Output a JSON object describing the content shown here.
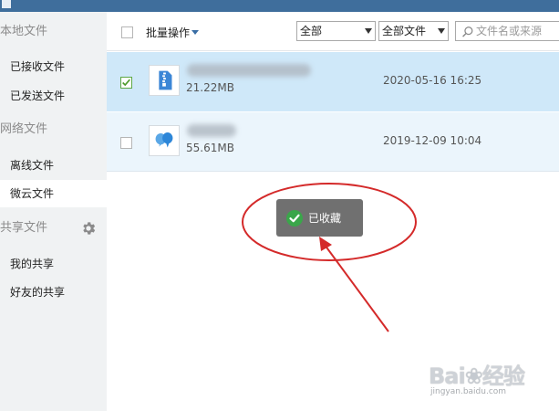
{
  "sidebar": {
    "sections": [
      {
        "label": "本地文件"
      },
      {
        "label": "网络文件"
      },
      {
        "label": "共享文件"
      }
    ],
    "items": [
      {
        "label": "已接收文件"
      },
      {
        "label": "已发送文件"
      },
      {
        "label": "离线文件"
      },
      {
        "label": "微云文件"
      },
      {
        "label": "我的共享"
      },
      {
        "label": "好友的共享"
      }
    ],
    "active_item": "微云文件",
    "settings_icon": "gear-icon"
  },
  "toolbar": {
    "batch_label": "批量操作",
    "filter_select": "全部",
    "type_select": "全部文件",
    "search_placeholder": "文件名或来源"
  },
  "files": [
    {
      "size": "21.22MB",
      "date": "2020-05-16 16:25",
      "checked": true,
      "icon": "zip-file-icon"
    },
    {
      "size": "55.61MB",
      "date": "2019-12-09 10:04",
      "checked": false,
      "icon": "chat-bubble-file-icon"
    }
  ],
  "toast": {
    "text": "已收藏",
    "icon": "check-circle-icon"
  },
  "colors": {
    "titlebar": "#3f6e9c",
    "selected_row": "#cfe8f9",
    "hover_row": "#ebf5fc",
    "toast_bg": "#707070",
    "check_green": "#3aa64a",
    "annotation_red": "#d42a2a"
  }
}
